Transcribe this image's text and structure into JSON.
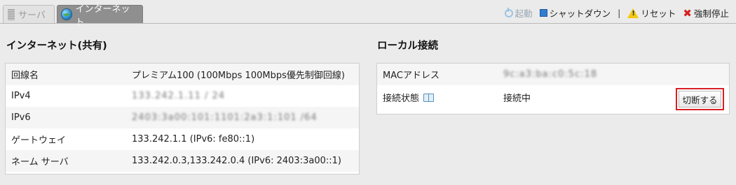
{
  "tabs": [
    {
      "label": "サーバ",
      "icon": "server-icon",
      "active": false
    },
    {
      "label": "インターネット",
      "icon": "globe-icon",
      "active": true
    }
  ],
  "toolbar": {
    "start_label": "起動",
    "shutdown_label": "シャットダウン",
    "separator": "|",
    "reset_label": "リセット",
    "force_stop_label": "強制停止"
  },
  "internet": {
    "title": "インターネット(共有)",
    "rows": [
      {
        "label": "回線名",
        "value": "プレミアム100 (100Mbps 100Mbps優先制御回線)"
      },
      {
        "label": "IPv4",
        "value": "133.242.1.11 / 24"
      },
      {
        "label": "IPv6",
        "value": "2403:3a00:101:1101:2a3:1:101 /64"
      },
      {
        "label": "ゲートウェイ",
        "value": "133.242.1.1 (IPv6: fe80::1)"
      },
      {
        "label": "ネーム サーバ",
        "value": "133.242.0.3,133.242.0.4 (IPv6: 2403:3a00::1)"
      }
    ]
  },
  "local": {
    "title": "ローカル接続",
    "mac_label": "MACアドレス",
    "mac_value": "9c:a3:ba:c0:5c:18",
    "status_label": "接続状態",
    "status_value": "接続中",
    "disconnect_label": "切断する"
  },
  "colors": {
    "highlight": "#d81f26",
    "active_tab": "#8f8f8f",
    "background": "#ebebeb"
  }
}
